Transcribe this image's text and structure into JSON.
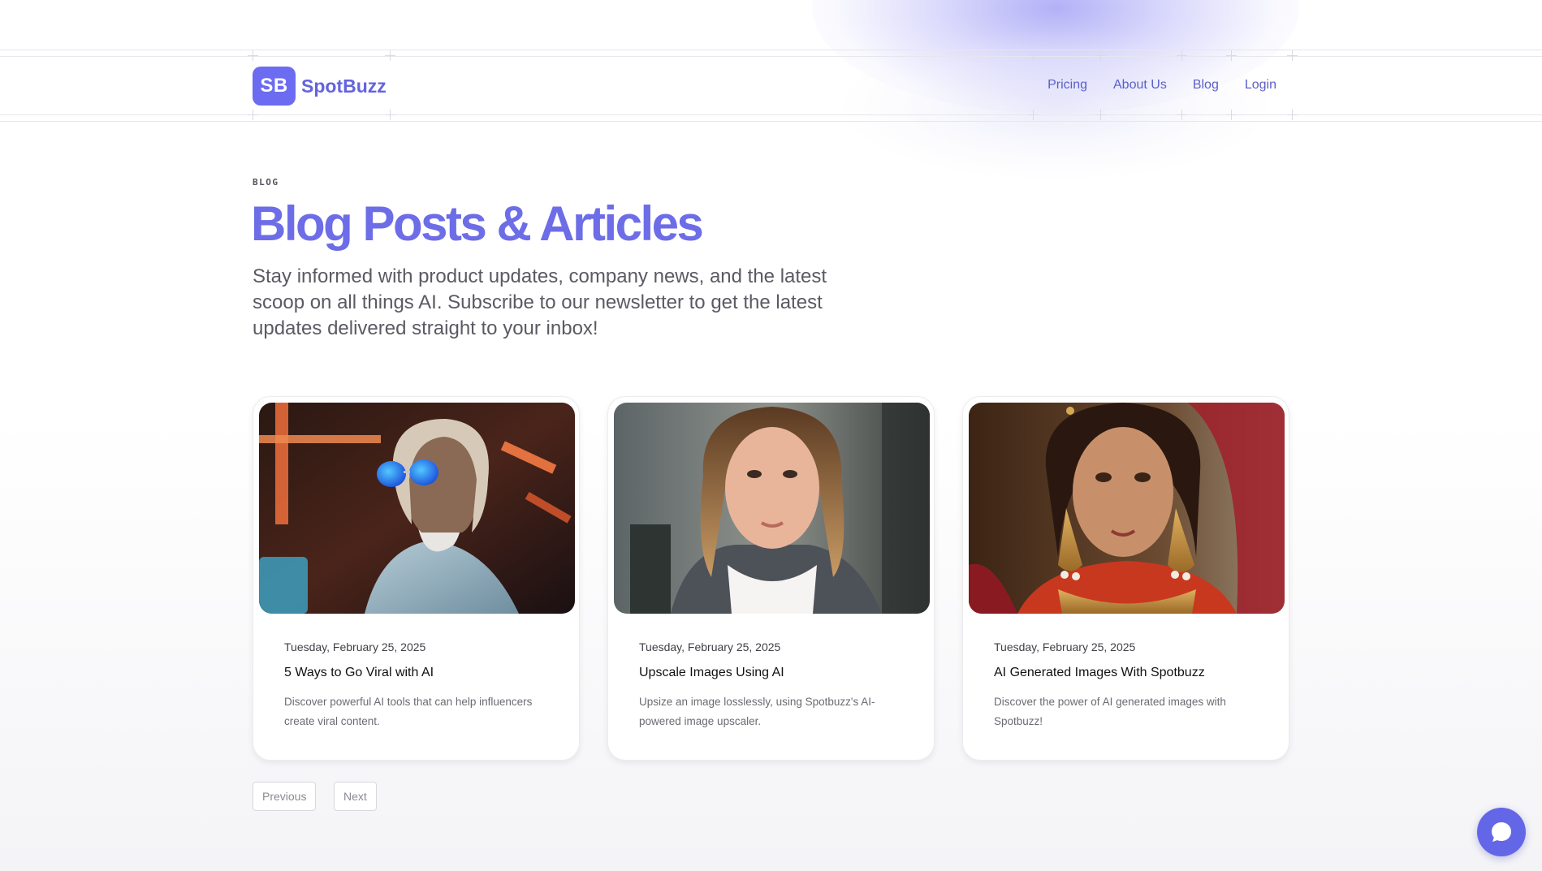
{
  "colors": {
    "brand": "#6c6cf2",
    "nav_link": "#5b5fc7",
    "title": "#6d6de8"
  },
  "logo": {
    "mark": "SB",
    "name": "SpotBuzz"
  },
  "nav": {
    "items": [
      {
        "label": "Pricing"
      },
      {
        "label": "About Us"
      },
      {
        "label": "Blog"
      },
      {
        "label": "Login"
      }
    ]
  },
  "hero": {
    "eyebrow": "BLOG",
    "title": "Blog Posts & Articles",
    "subtitle": "Stay informed with product updates, company news, and the latest scoop on all things AI. Subscribe to our newsletter to get the latest updates delivered straight to your inbox!"
  },
  "posts": [
    {
      "date": "Tuesday, February 25, 2025",
      "title": "5 Ways to Go Viral with AI",
      "description": "Discover powerful AI tools that can help influencers create viral content."
    },
    {
      "date": "Tuesday, February 25, 2025",
      "title": "Upscale Images Using AI",
      "description": "Upsize an image losslessly, using Spotbuzz's AI-powered image upscaler."
    },
    {
      "date": "Tuesday, February 25, 2025",
      "title": "AI Generated Images With Spotbuzz",
      "description": "Discover the power of AI generated images with Spotbuzz!"
    }
  ],
  "pagination": {
    "previous": "Previous",
    "next": "Next"
  },
  "chat": {
    "icon": "chat-bubble-icon"
  }
}
